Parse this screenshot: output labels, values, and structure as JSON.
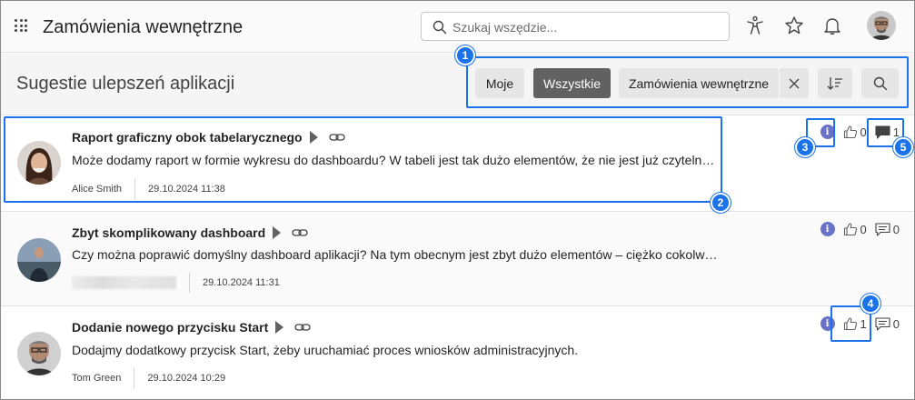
{
  "app": {
    "title": "Zamówienia wewnętrzne",
    "search_placeholder": "Szukaj wszędzie..."
  },
  "header": {
    "page_title": "Sugestie ulepszeń aplikacji",
    "filters": {
      "mine": "Moje",
      "all": "Wszystkie",
      "app_filter": "Zamówienia wewnętrzne"
    }
  },
  "suggestions": [
    {
      "title": "Raport graficzny obok tabelarycznego",
      "description": "Może dodamy raport w formie wykresu do dashboardu? W tabeli jest tak dużo elementów, że nie jest już czytelna...",
      "author": "Alice Smith",
      "date": "29.10.2024 11:38",
      "likes": "0",
      "comments": "1"
    },
    {
      "title": "Zbyt skomplikowany dashboard",
      "description": "Czy można poprawić domyślny dashboard aplikacji? Na tym obecnym jest zbyt dużo elementów – ciężko cokolwiek znaleźć!",
      "author": "",
      "date": "29.10.2024 11:31",
      "likes": "0",
      "comments": "0"
    },
    {
      "title": "Dodanie nowego przycisku Start",
      "description": "Dodajmy dodatkowy przycisk Start, żeby uruchamiać proces wniosków administracyjnych.",
      "author": "Tom Green",
      "date": "29.10.2024 10:29",
      "likes": "1",
      "comments": "0"
    }
  ],
  "annotations": [
    "1",
    "2",
    "3",
    "4",
    "5"
  ],
  "colors": {
    "accent": "#1a73e8",
    "active_filter": "#616161",
    "info": "#6a72c8"
  },
  "icons": {
    "apps": "waffle-icon",
    "search": "search-icon",
    "accessibility": "accessibility-icon",
    "favorites": "star-icon",
    "notifications": "bell-icon",
    "clear": "close-icon",
    "sort": "sort-icon",
    "arrow": "play-arrow-icon",
    "link": "link-icon",
    "info": "info-icon",
    "like": "thumbs-up-icon",
    "comment": "comment-icon"
  }
}
